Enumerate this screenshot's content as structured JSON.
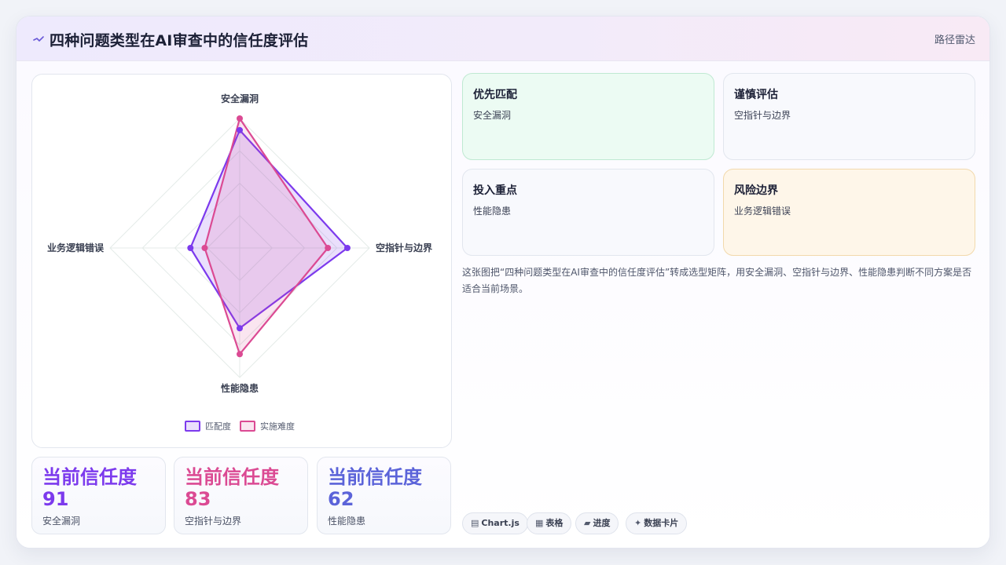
{
  "header": {
    "title": "四种问题类型在AI审查中的信任度评估",
    "tag": "路径雷达",
    "icon": "sparkline-icon"
  },
  "chart_data": {
    "type": "radar",
    "axes": [
      "安全漏洞",
      "空指针与边界",
      "性能隐患",
      "业务逻辑错误"
    ],
    "rmax": 100,
    "series": [
      {
        "name": "匹配度",
        "values": [
          91,
          83,
          62,
          38
        ],
        "color": "#7c3aed",
        "fill": "rgba(124,58,237,0.16)"
      },
      {
        "name": "实施难度",
        "values": [
          100,
          68,
          82,
          27
        ],
        "color": "#db4a93",
        "fill": "rgba(219,74,147,0.14)"
      }
    ],
    "grid_rings": 4,
    "legend_position": "bottom"
  },
  "stats": [
    {
      "title": "当前信任度",
      "value": "91",
      "label": "安全漏洞",
      "color": "#7c3aed"
    },
    {
      "title": "当前信任度",
      "value": "83",
      "label": "空指针与边界",
      "color": "#db4a93"
    },
    {
      "title": "当前信任度",
      "value": "62",
      "label": "性能隐患",
      "color": "#5b63d9"
    }
  ],
  "tiles": [
    {
      "title": "优先匹配",
      "sub": "安全漏洞",
      "bg": "#ecfbf3",
      "border": "#bfe9d2"
    },
    {
      "title": "谨慎评估",
      "sub": "空指针与边界",
      "bg": "#f8f9fd",
      "border": "#e2e6ee"
    },
    {
      "title": "投入重点",
      "sub": "性能隐患",
      "bg": "#f8f9fd",
      "border": "#e2e6ee"
    },
    {
      "title": "风险边界",
      "sub": "业务逻辑错误",
      "bg": "#fef6e9",
      "border": "#f2d9ac"
    }
  ],
  "description": "这张图把“四种问题类型在AI审查中的信任度评估”转成选型矩阵，用安全漏洞、空指针与边界、性能隐患判断不同方案是否适合当前场景。",
  "chips": [
    {
      "glyph": "▤",
      "label": "Chart.js",
      "icon": "chart-icon"
    },
    {
      "glyph": "▦",
      "label": "表格",
      "icon": "table-icon"
    },
    {
      "glyph": "▰",
      "label": "进度",
      "icon": "progress-icon"
    },
    {
      "glyph": "✦",
      "label": "数据卡片",
      "icon": "sparkle-icon"
    }
  ]
}
